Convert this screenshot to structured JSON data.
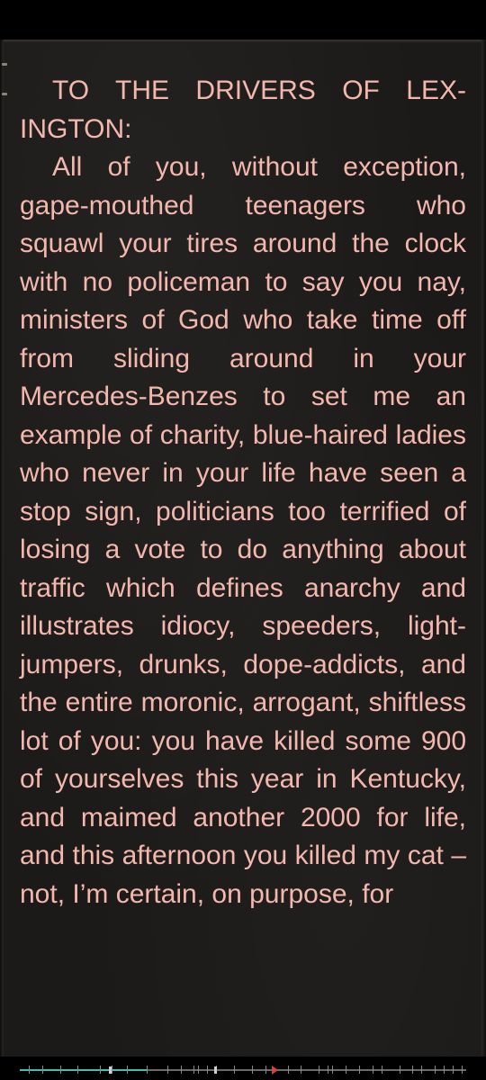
{
  "book": {
    "heading": "TO THE DRIVERS OF LEX­INGTON:",
    "paragraph": "All of you, without exception, gape-mouthed teenagers who squawl your tires around the clock with no policeman to say you nay, ministers of God who take time off from sliding around in your Mercedes-Ben­zes to set me an example of charity, blue-haired ladies who never in your life have seen a stop sign, politicians too terri­fied of losing a vote to do any­thing about traffic which defines anarchy and illustrates idiocy, speeders, light-jumpers, drunks, dope-addicts, and the entire moronic, arrogant, shift­less lot of you: you have killed some 900 of yourselves this year in Kentucky, and maimed another 2000 for life, and this afternoon you killed my cat – not, I’m certain, on purpose, for"
  },
  "progress": {
    "fraction": 0.285,
    "position_fraction": 0.565
  },
  "colors": {
    "page_background": "#1c1a18",
    "text": "#f4b7ad",
    "progress_fill": "#3fc1b1",
    "position_marker": "#d0463a"
  }
}
